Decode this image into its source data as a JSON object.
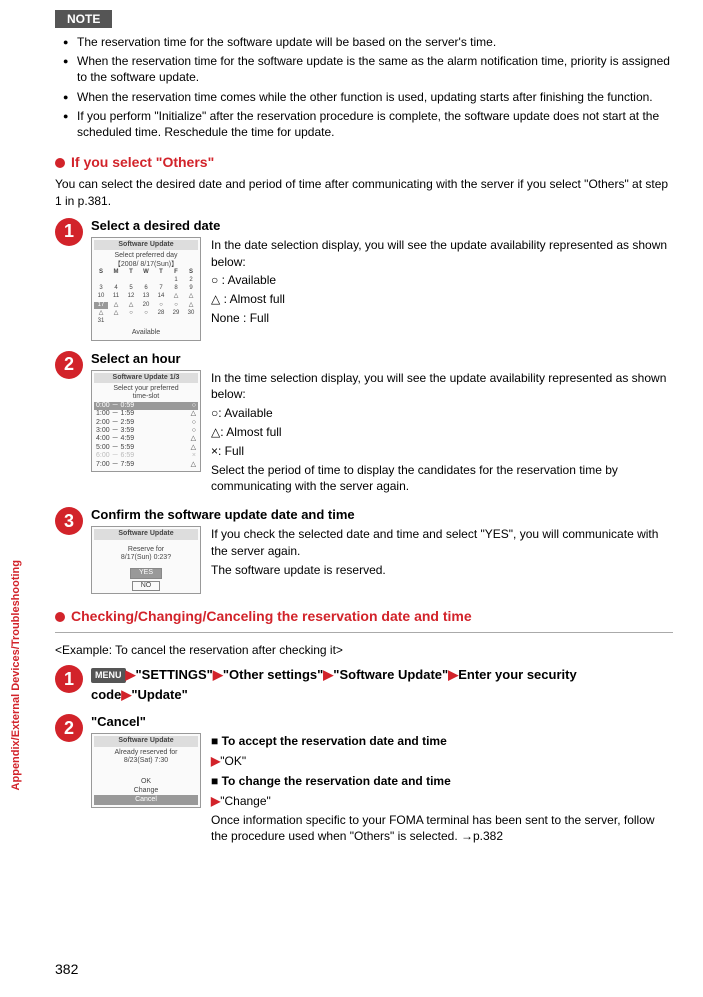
{
  "note": {
    "badge": "NOTE",
    "items": [
      "The reservation time for the software update will be based on the server's time.",
      "When the reservation time for the software update is the same as the alarm notification time, priority is assigned to the software update.",
      "When the reservation time comes while the other function is used, updating starts after finishing the function.",
      "If you perform \"Initialize\" after the reservation procedure is complete, the software update does not start at the scheduled time. Reschedule the time for update."
    ]
  },
  "sectionOthers": {
    "heading": "If you select \"Others\"",
    "intro": "You can select the desired date and period of time after communicating with the server if you select \"Others\" at step 1 in p.381."
  },
  "steps": {
    "s1": {
      "num": "1",
      "title": "Select a desired date",
      "desc": "In the date selection display, you will see the update availability represented as shown below:",
      "legend1": "○      : Available",
      "legend2": "△      : Almost full",
      "legend3": "None : Full",
      "screen": {
        "header": "Software Update",
        "line1": "Select preferred day",
        "line2": "【2008/ 8/17(Sun)】",
        "days": [
          "S",
          "M",
          "T",
          "W",
          "T",
          "F",
          "S"
        ],
        "footer": "Available"
      }
    },
    "s2": {
      "num": "2",
      "title": "Select an hour",
      "desc": "In the time selection display, you will see the update availability represented as shown below:",
      "legend1": "○: Available",
      "legend2": "△: Almost full",
      "legend3": "×: Full",
      "extra": "Select the period of time to display the candidates for the reservation time by communicating with the server again.",
      "screen": {
        "header": "Software Update  1/3",
        "line1": "Select your preferred",
        "line2": "time-slot",
        "rows": [
          [
            "0:00 － 0:59",
            "○"
          ],
          [
            "1:00 － 1:59",
            "△"
          ],
          [
            "2:00 － 2:59",
            "○"
          ],
          [
            "3:00 － 3:59",
            "○"
          ],
          [
            "4:00 － 4:59",
            "△"
          ],
          [
            "5:00 － 5:59",
            "△"
          ],
          [
            "6:00 － 6:59",
            "×"
          ],
          [
            "7:00 － 7:59",
            "△"
          ]
        ]
      }
    },
    "s3": {
      "num": "3",
      "title": "Confirm the software update date and time",
      "desc1": "If you check the selected date and time and select \"YES\", you will communicate with the server again.",
      "desc2": "The software update is reserved.",
      "screen": {
        "header": "Software Update",
        "line1": "Reserve for",
        "line2": "8/17(Sun) 0:23?",
        "yes": "YES",
        "no": "NO"
      }
    }
  },
  "sectionCheck": {
    "heading": "Checking/Changing/Canceling the reservation date and time",
    "example": "<Example: To cancel the reservation after checking it>"
  },
  "navStep": {
    "num": "1",
    "menu": "MENU",
    "p1": "\"SETTINGS\"",
    "p2": "\"Other settings\"",
    "p3": "\"Software Update\"",
    "p4": "Enter your security code",
    "p5": "\"Update\""
  },
  "cancelStep": {
    "num": "2",
    "title": "\"Cancel\"",
    "screen": {
      "header": "Software Update",
      "line1": "Already reserved for",
      "line2": "8/23(Sat) 7:30",
      "opt1": "OK",
      "opt2": "Change",
      "opt3": "Cancel"
    },
    "accept_h": "■ To accept the reservation date and time",
    "accept_t": "\"OK\"",
    "change_h": "■ To change the reservation date and time",
    "change_t": "\"Change\"",
    "change_desc": "Once information specific to your FOMA terminal has been sent to the server, follow the procedure used when \"Others\" is selected. →p.382"
  },
  "sideTab": "Appendix/External Devices/Troubleshooting",
  "pageNum": "382",
  "arrow": "▶"
}
